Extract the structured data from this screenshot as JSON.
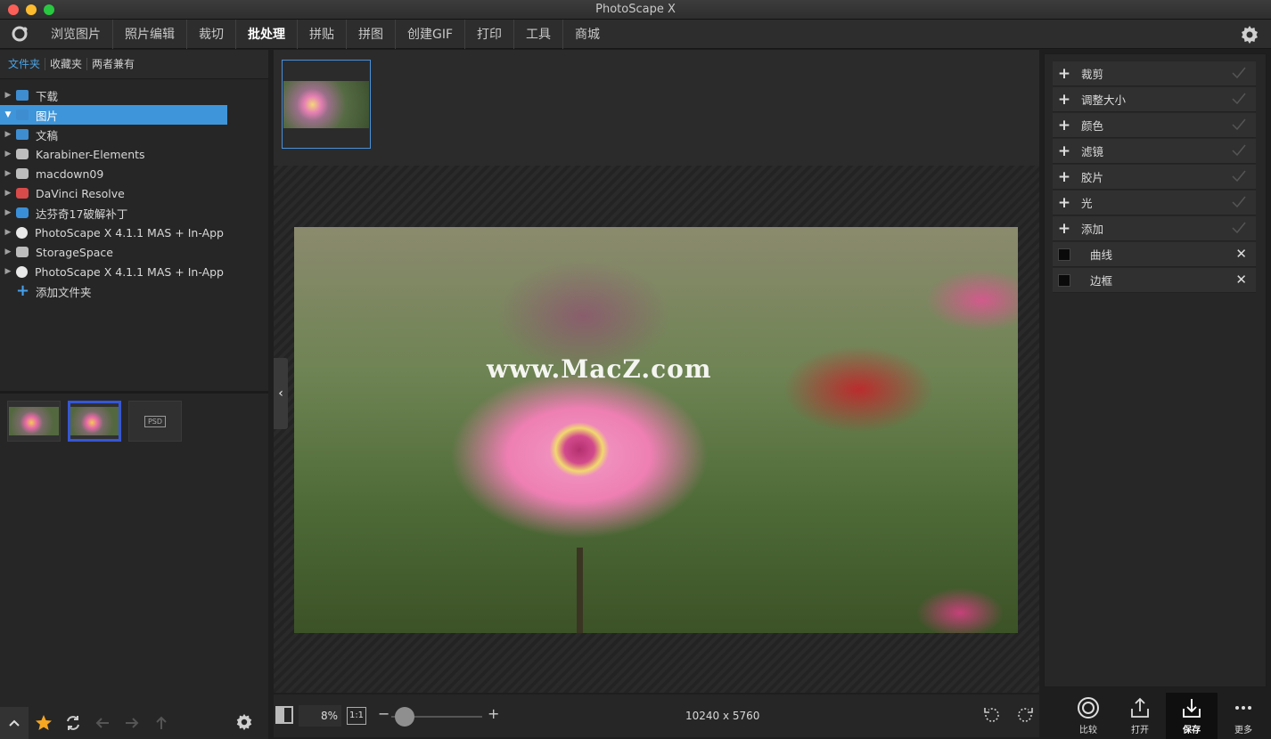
{
  "window": {
    "title": "PhotoScape X"
  },
  "menu": {
    "items": [
      {
        "label": "浏览图片",
        "active": false
      },
      {
        "label": "照片编辑",
        "active": false
      },
      {
        "label": "裁切",
        "active": false
      },
      {
        "label": "批处理",
        "active": true
      },
      {
        "label": "拼贴",
        "active": false
      },
      {
        "label": "拼图",
        "active": false
      },
      {
        "label": "创建GIF",
        "active": false
      },
      {
        "label": "打印",
        "active": false
      },
      {
        "label": "工具",
        "active": false
      },
      {
        "label": "商城",
        "active": false
      }
    ]
  },
  "left": {
    "tabs": [
      {
        "label": "文件夹",
        "active": true
      },
      {
        "label": "收藏夹",
        "active": false
      },
      {
        "label": "两者兼有",
        "active": false
      }
    ],
    "tree": [
      {
        "label": "下载",
        "icon": "folder-icon",
        "selected": false
      },
      {
        "label": "图片",
        "icon": "folder-icon",
        "selected": true
      },
      {
        "label": "文稿",
        "icon": "folder-icon",
        "selected": false
      },
      {
        "label": "Karabiner-Elements",
        "icon": "app-disk-icon",
        "selected": false
      },
      {
        "label": "macdown09",
        "icon": "disk-icon",
        "selected": false
      },
      {
        "label": "DaVinci Resolve",
        "icon": "app-disk-icon",
        "selected": false
      },
      {
        "label": "达芬奇17破解补丁",
        "icon": "app-disk-icon",
        "selected": false
      },
      {
        "label": "PhotoScape X 4.1.1 MAS + In-App",
        "icon": "photoscape-icon",
        "selected": false
      },
      {
        "label": "StorageSpace",
        "icon": "disk-icon",
        "selected": false
      },
      {
        "label": "PhotoScape X 4.1.1 MAS + In-App",
        "icon": "photoscape-icon",
        "selected": false
      }
    ],
    "add_folder": "添加文件夹",
    "psd_label": "PSD"
  },
  "viewer": {
    "watermark": "www.MacZ.com",
    "zoom": "8%",
    "one_to_one": "1:1",
    "dimensions": "10240 x 5760",
    "zoom_level": 0.08
  },
  "right": {
    "adjustments": [
      {
        "label": "裁剪",
        "type": "plus"
      },
      {
        "label": "调整大小",
        "type": "plus"
      },
      {
        "label": "颜色",
        "type": "plus"
      },
      {
        "label": "滤镜",
        "type": "plus"
      },
      {
        "label": "胶片",
        "type": "plus"
      },
      {
        "label": "光",
        "type": "plus"
      },
      {
        "label": "添加",
        "type": "plus"
      },
      {
        "label": "曲线",
        "type": "box"
      },
      {
        "label": "边框",
        "type": "box"
      }
    ],
    "footer": [
      {
        "label": "比较",
        "icon": "compare-icon",
        "active": false
      },
      {
        "label": "打开",
        "icon": "share-icon",
        "active": false
      },
      {
        "label": "保存",
        "icon": "save-icon",
        "active": true
      },
      {
        "label": "更多",
        "icon": "more-icon",
        "active": false
      }
    ]
  },
  "colors": {
    "accent": "#3f95d9",
    "active_tab": "#4aa3e4",
    "selected_thumb_border": "#3557d6",
    "star": "#f5a623"
  }
}
